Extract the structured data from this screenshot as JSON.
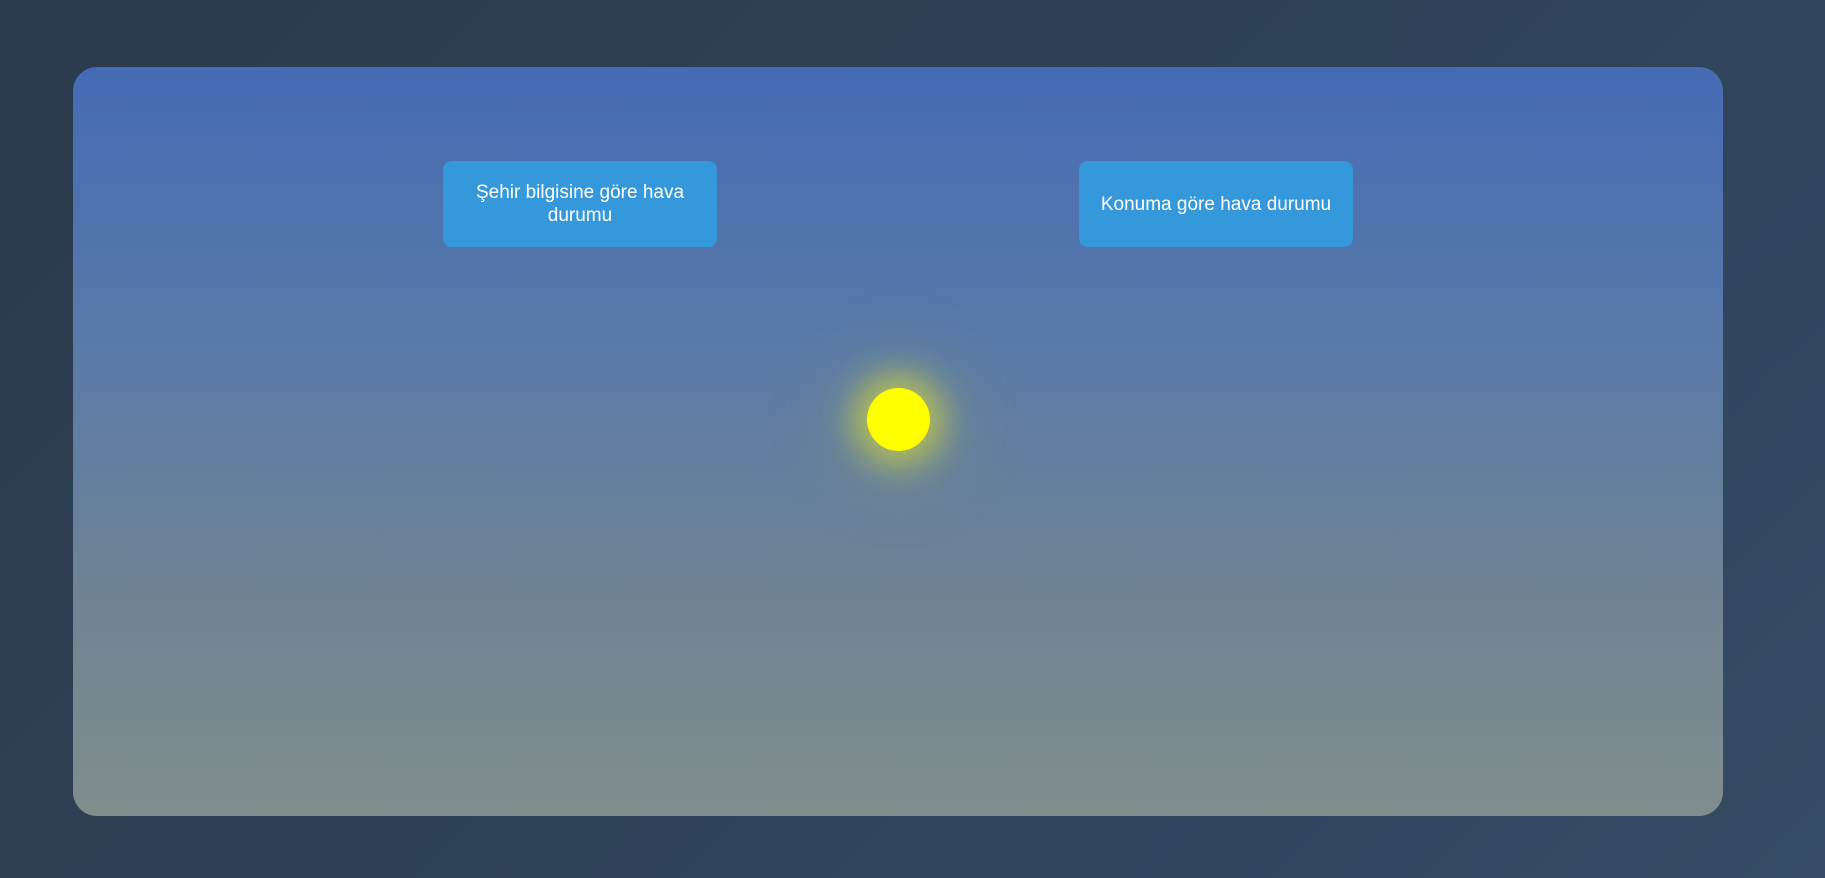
{
  "buttons": {
    "city_weather_label": "Şehir bilgisine göre hava durumu",
    "location_weather_label": "Konuma göre hava durumu"
  },
  "icons": {
    "sun": "sun-icon"
  },
  "colors": {
    "button_bg": "#3498db",
    "sun": "#ffff00",
    "card_top": "#456bb5",
    "card_bottom": "#808d8c",
    "page_bg": "#2f435a"
  }
}
